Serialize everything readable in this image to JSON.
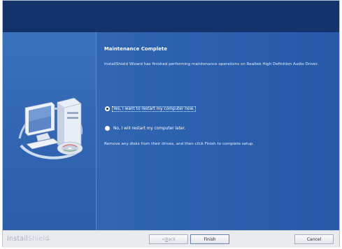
{
  "maintenance": {
    "title": "Maintenance Complete",
    "description": "InstallShield Wizard has finished performing maintenance operations on Realtek High Definition Audio Driver.",
    "options": [
      {
        "label": "Yes, I want to restart my computer now.",
        "selected": true
      },
      {
        "label": "No, I will restart my computer later.",
        "selected": false
      }
    ],
    "instruction": "Remove any disks from their drives, and then click Finish to complete setup."
  },
  "footer": {
    "brand_part1": "Install",
    "brand_part2": "Shield",
    "back_prefix": "< ",
    "back_mnemonic": "B",
    "back_rest": "ack",
    "finish_label": "Finish",
    "cancel_label": "Cancel"
  },
  "icons": {
    "illustration": "computer-with-cd-icon"
  },
  "colors": {
    "header_band": "#14336b",
    "panel_blue": "#2e63b0",
    "footer_bg": "#e9ebef"
  }
}
